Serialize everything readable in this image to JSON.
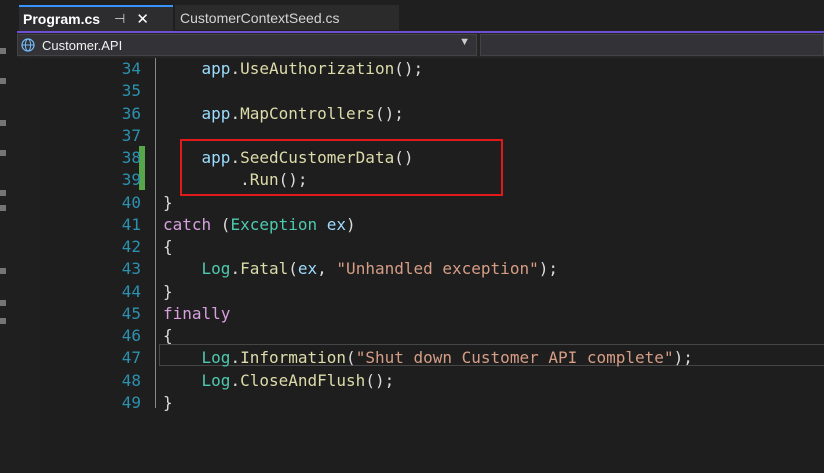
{
  "tabs": [
    {
      "label": "Program.cs",
      "active": true,
      "pinned": true
    },
    {
      "label": "CustomerContextSeed.cs",
      "active": false
    }
  ],
  "navbar": {
    "project": "Customer.API"
  },
  "colors": {
    "accent": "#6e4ed2",
    "line_number": "#2b91af",
    "change_bar": "#57a64a",
    "highlight_box": "#e0191b"
  },
  "code": [
    {
      "n": "34",
      "t": [
        [
          "    ",
          ""
        ],
        [
          "app",
          "var"
        ],
        [
          ".",
          ""
        ],
        [
          "UseAuthorization",
          "mth"
        ],
        [
          "();",
          ""
        ]
      ]
    },
    {
      "n": "35",
      "t": []
    },
    {
      "n": "36",
      "t": [
        [
          "    ",
          ""
        ],
        [
          "app",
          "var"
        ],
        [
          ".",
          ""
        ],
        [
          "MapControllers",
          "mth"
        ],
        [
          "();",
          ""
        ]
      ]
    },
    {
      "n": "37",
      "t": []
    },
    {
      "n": "38",
      "t": [
        [
          "    ",
          ""
        ],
        [
          "app",
          "var"
        ],
        [
          ".",
          ""
        ],
        [
          "SeedCustomerData",
          "mth"
        ],
        [
          "()",
          ""
        ]
      ]
    },
    {
      "n": "39",
      "t": [
        [
          "        .",
          ""
        ],
        [
          "Run",
          "mth"
        ],
        [
          "();",
          ""
        ]
      ]
    },
    {
      "n": "40",
      "t": [
        [
          "}",
          ""
        ]
      ]
    },
    {
      "n": "41",
      "t": [
        [
          "catch",
          "kw"
        ],
        [
          " (",
          ""
        ],
        [
          "Exception",
          "typ"
        ],
        [
          " ",
          ""
        ],
        [
          "ex",
          "var"
        ],
        [
          ")",
          ""
        ]
      ]
    },
    {
      "n": "42",
      "t": [
        [
          "{",
          ""
        ]
      ]
    },
    {
      "n": "43",
      "t": [
        [
          "    ",
          ""
        ],
        [
          "Log",
          "typ"
        ],
        [
          ".",
          ""
        ],
        [
          "Fatal",
          "mth"
        ],
        [
          "(",
          ""
        ],
        [
          "ex",
          "var"
        ],
        [
          ", ",
          ""
        ],
        [
          "\"Unhandled exception\"",
          "str"
        ],
        [
          ");",
          ""
        ]
      ]
    },
    {
      "n": "44",
      "t": [
        [
          "}",
          ""
        ]
      ]
    },
    {
      "n": "45",
      "t": [
        [
          "finally",
          "kw"
        ]
      ]
    },
    {
      "n": "46",
      "t": [
        [
          "{",
          ""
        ]
      ]
    },
    {
      "n": "47",
      "t": [
        [
          "    ",
          ""
        ],
        [
          "Log",
          "typ"
        ],
        [
          ".",
          ""
        ],
        [
          "Information",
          "mth"
        ],
        [
          "(",
          ""
        ],
        [
          "\"Shut down Customer API complete\"",
          "str"
        ],
        [
          ");",
          ""
        ]
      ]
    },
    {
      "n": "48",
      "t": [
        [
          "    ",
          ""
        ],
        [
          "Log",
          "typ"
        ],
        [
          ".",
          ""
        ],
        [
          "CloseAndFlush",
          "mth"
        ],
        [
          "();",
          ""
        ]
      ]
    },
    {
      "n": "49",
      "t": [
        [
          "}",
          ""
        ]
      ]
    }
  ]
}
